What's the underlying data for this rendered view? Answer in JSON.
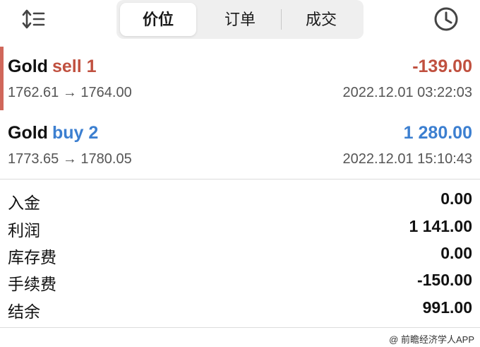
{
  "toolbar": {
    "sort_icon": "sort-arrows-list-icon",
    "history_icon": "clock-icon",
    "tabs": [
      {
        "label": "价位",
        "active": true
      },
      {
        "label": "订单",
        "active": false
      },
      {
        "label": "成交",
        "active": false
      }
    ]
  },
  "trades": [
    {
      "symbol": "Gold",
      "side": "sell 1",
      "profit": "-139.00",
      "prices": "1762.61 → 1764.00",
      "time": "2022.12.01 03:22:03",
      "side_color": "#c0503f",
      "profit_color": "#c0503f",
      "accent_color": "#d0675a"
    },
    {
      "symbol": "Gold",
      "side": "buy 2",
      "profit": "1 280.00",
      "prices": "1773.65 → 1780.05",
      "time": "2022.12.01 15:10:43",
      "side_color": "#3c7fd0",
      "profit_color": "#3c7fd0"
    }
  ],
  "summary": [
    {
      "label": "入金",
      "value": "0.00"
    },
    {
      "label": "利润",
      "value": "1 141.00"
    },
    {
      "label": "库存费",
      "value": "0.00"
    },
    {
      "label": "手续费",
      "value": "-150.00"
    },
    {
      "label": "结余",
      "value": "991.00"
    }
  ],
  "watermark": "@ 前瞻经济学人APP"
}
